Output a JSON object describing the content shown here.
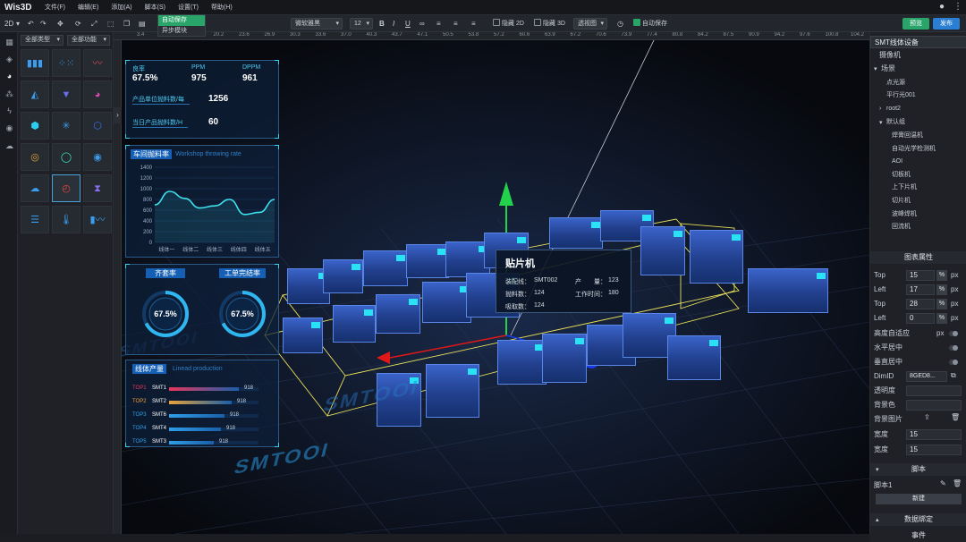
{
  "app": {
    "logo": "Wis3D",
    "menus": [
      "文件(F)",
      "编辑(E)",
      "添加(A)",
      "脚本(S)",
      "设置(T)",
      "帮助(H)"
    ]
  },
  "toolbar": {
    "mode": "2D",
    "font_family": "微软雅黑",
    "font_size": "12",
    "bold": "B",
    "italic": "I",
    "underline": "U",
    "hide2d": "隐藏 2D",
    "hide3d": "隐藏 3D",
    "view": "透视图",
    "autosave": "自动保存",
    "preview": "预览",
    "publish": "发布"
  },
  "dropdown": {
    "items": [
      "自动保存",
      "异步模块"
    ]
  },
  "left": {
    "type_filter": "全部类型",
    "func_filter": "全部功能"
  },
  "ruler": {
    "top": [
      "3.4",
      "15.8",
      "18.6",
      "20.2",
      "23.6",
      "26.9",
      "30.3",
      "33.6",
      "37.0",
      "40.3",
      "43.7",
      "47.1",
      "50.5",
      "53.8",
      "57.2",
      "60.6",
      "63.9",
      "67.2",
      "70.6",
      "73.9",
      "77.4",
      "80.8",
      "84.2",
      "87.5",
      "90.9",
      "94.2",
      "97.6",
      "100.8",
      "104.2",
      "107.5"
    ]
  },
  "stats": {
    "yield_label": "良率",
    "yield_value": "67.5%",
    "ppm_label": "PPM",
    "ppm_value": "975",
    "dppm_label": "DPPM",
    "dppm_value": "961",
    "row1_label": "产品单位抛料数/每",
    "row1_value": "1256",
    "row2_label": "当日产品抛料数/H",
    "row2_value": "60"
  },
  "throw_chart": {
    "title": "车间抛料率",
    "subtitle": "Workshop throwing rate",
    "ticks": [
      "1400",
      "1200",
      "1000",
      "800",
      "600",
      "400",
      "200",
      "0"
    ],
    "categories": [
      "线体一",
      "线体二",
      "线体三",
      "线体四",
      "线体五"
    ]
  },
  "chart_data": {
    "type": "line",
    "title": "车间抛料率",
    "categories": [
      "线体一",
      "线体二",
      "线体三",
      "线体四",
      "线体五"
    ],
    "x": [
      0,
      0.5,
      1,
      1.5,
      2,
      2.5,
      3,
      3.5,
      4
    ],
    "values": [
      700,
      950,
      820,
      640,
      680,
      800,
      520,
      560,
      800
    ],
    "ylim": [
      0,
      1400
    ],
    "grid": true
  },
  "gauges": {
    "g1_label": "齐套率",
    "g1_value": "67.5%",
    "g2_label": "工单完结率",
    "g2_value": "67.5%"
  },
  "line_output": {
    "title": "线体产量",
    "subtitle": "Linead production",
    "rows": [
      {
        "rank": "TOP1",
        "name": "SMT1",
        "value": "918",
        "color": "#e8365d",
        "frac": 0.78
      },
      {
        "rank": "TOP2",
        "name": "SMT2",
        "value": "918",
        "color": "#e8a23a",
        "frac": 0.7
      },
      {
        "rank": "TOP3",
        "name": "SMT6",
        "value": "918",
        "color": "#2f9ee8",
        "frac": 0.62
      },
      {
        "rank": "TOP4",
        "name": "SMT4",
        "value": "918",
        "color": "#2f9ee8",
        "frac": 0.58
      },
      {
        "rank": "TOP5",
        "name": "SMT3",
        "value": "918",
        "color": "#2f9ee8",
        "frac": 0.5
      }
    ]
  },
  "tooltip": {
    "title": "贴片机",
    "line_label": "装配线：",
    "line_value": "SMT002",
    "prod_label": "产　　量：",
    "prod_value": "123",
    "throw_label": "抛料数：",
    "throw_value": "124",
    "time_label": "工作时间：",
    "time_value": "180",
    "pick_label": "吸取数：",
    "pick_value": "124"
  },
  "floor_text": [
    "SMTOOI",
    "SMTOOI",
    "SMTOOI"
  ],
  "tree": {
    "root": "SMT线体设备",
    "camera": "摄像机",
    "scene": "场景",
    "point_light": "点光源",
    "parallel_light": "平行光001",
    "root2": "root2",
    "default_group": "默认组",
    "items": [
      "焊膏回温机",
      "自动光学检测机",
      "AOI",
      "切板机",
      "上下片机",
      "切片机",
      "波峰焊机",
      "回流机"
    ]
  },
  "props": {
    "header": "图表属性",
    "rows": [
      {
        "label": "Top",
        "value": "15",
        "unit": "px"
      },
      {
        "label": "Left",
        "value": "17",
        "unit": "px"
      },
      {
        "label": "Top",
        "value": "28",
        "unit": "px"
      },
      {
        "label": "Left",
        "value": "0",
        "unit": "px"
      }
    ],
    "auto_height": "高度自适应",
    "px": "px",
    "h_center": "水平居中",
    "v_center": "垂直居中",
    "dim_label": "DimID",
    "dim_value": "8GED8...",
    "opacity": "透明度",
    "bg_color": "背景色",
    "bg_image": "背景图片",
    "width_label": "宽度",
    "width_value": "15",
    "border_label": "宽度",
    "border_value": "15",
    "script_header": "脚本",
    "script1": "脚本1",
    "new_btn": "新建",
    "binding_header": "数据绑定",
    "events": "事件"
  }
}
